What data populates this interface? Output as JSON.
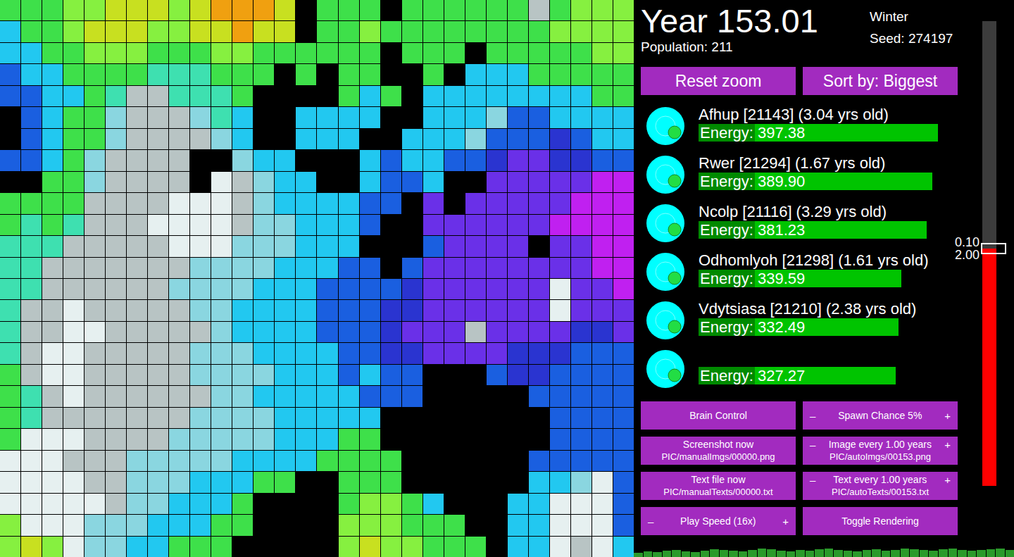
{
  "map": {
    "palette": [
      "#000000",
      "#1a5fe0",
      "#22c8f0",
      "#3ee0b0",
      "#3ee04a",
      "#86f040",
      "#c8e020",
      "#f0a010",
      "#b8c4c4",
      "#e6f0f0",
      "#6a30e8",
      "#c020f0",
      "#2a34d0",
      "#8ad6e0"
    ],
    "rows": [
      [
        4,
        4,
        4,
        5,
        5,
        6,
        6,
        6,
        5,
        6,
        7,
        7,
        7,
        6,
        0,
        4,
        4,
        4,
        0,
        4,
        4,
        4,
        4,
        4,
        4,
        8,
        4,
        5,
        5,
        5
      ],
      [
        2,
        4,
        4,
        5,
        6,
        6,
        6,
        5,
        5,
        6,
        6,
        7,
        6,
        6,
        0,
        4,
        4,
        5,
        4,
        4,
        4,
        4,
        4,
        4,
        4,
        4,
        5,
        5,
        5,
        5
      ],
      [
        2,
        2,
        4,
        4,
        5,
        5,
        5,
        4,
        4,
        4,
        5,
        5,
        4,
        4,
        4,
        4,
        4,
        4,
        0,
        4,
        4,
        4,
        0,
        4,
        4,
        4,
        4,
        4,
        5,
        5
      ],
      [
        1,
        2,
        2,
        4,
        4,
        4,
        4,
        3,
        3,
        3,
        4,
        4,
        4,
        0,
        4,
        0,
        4,
        4,
        0,
        0,
        4,
        0,
        2,
        2,
        2,
        4,
        4,
        4,
        4,
        4
      ],
      [
        1,
        1,
        2,
        2,
        4,
        3,
        8,
        8,
        3,
        3,
        3,
        4,
        0,
        0,
        0,
        0,
        4,
        2,
        4,
        0,
        2,
        2,
        2,
        2,
        2,
        2,
        2,
        2,
        4,
        4
      ],
      [
        0,
        1,
        2,
        4,
        4,
        13,
        8,
        8,
        8,
        13,
        3,
        2,
        0,
        0,
        2,
        2,
        2,
        2,
        0,
        0,
        2,
        2,
        2,
        13,
        1,
        1,
        2,
        2,
        2,
        2
      ],
      [
        0,
        1,
        2,
        4,
        4,
        13,
        8,
        8,
        8,
        8,
        13,
        2,
        0,
        0,
        2,
        2,
        2,
        0,
        0,
        2,
        2,
        2,
        13,
        1,
        1,
        1,
        12,
        1,
        2,
        2
      ],
      [
        1,
        1,
        2,
        4,
        13,
        8,
        8,
        8,
        8,
        0,
        0,
        13,
        2,
        2,
        0,
        0,
        0,
        2,
        1,
        2,
        2,
        1,
        1,
        12,
        10,
        10,
        12,
        12,
        1,
        1
      ],
      [
        0,
        0,
        4,
        4,
        13,
        8,
        8,
        8,
        8,
        0,
        9,
        8,
        13,
        2,
        2,
        0,
        0,
        2,
        1,
        1,
        2,
        0,
        0,
        10,
        10,
        10,
        10,
        10,
        11,
        11
      ],
      [
        4,
        4,
        4,
        4,
        8,
        8,
        8,
        8,
        9,
        9,
        9,
        8,
        13,
        2,
        2,
        2,
        2,
        1,
        1,
        0,
        10,
        0,
        10,
        10,
        10,
        10,
        10,
        11,
        11,
        11
      ],
      [
        4,
        3,
        4,
        3,
        8,
        8,
        8,
        9,
        9,
        9,
        9,
        8,
        13,
        13,
        2,
        2,
        2,
        1,
        0,
        0,
        10,
        10,
        10,
        10,
        10,
        10,
        11,
        11,
        11,
        11
      ],
      [
        3,
        3,
        3,
        8,
        8,
        8,
        8,
        8,
        9,
        9,
        9,
        13,
        13,
        13,
        2,
        2,
        2,
        0,
        0,
        0,
        1,
        10,
        10,
        10,
        10,
        0,
        10,
        10,
        11,
        11
      ],
      [
        3,
        3,
        8,
        8,
        8,
        8,
        8,
        8,
        8,
        13,
        13,
        13,
        13,
        2,
        2,
        2,
        1,
        1,
        0,
        1,
        10,
        10,
        10,
        10,
        10,
        10,
        10,
        10,
        11,
        11
      ],
      [
        3,
        3,
        8,
        8,
        8,
        8,
        8,
        8,
        13,
        13,
        13,
        13,
        2,
        2,
        2,
        1,
        1,
        1,
        1,
        12,
        10,
        10,
        10,
        10,
        10,
        10,
        9,
        10,
        10,
        11
      ],
      [
        3,
        8,
        8,
        9,
        8,
        8,
        8,
        8,
        8,
        13,
        13,
        2,
        2,
        2,
        2,
        1,
        1,
        1,
        12,
        12,
        10,
        10,
        10,
        10,
        10,
        10,
        9,
        10,
        10,
        10
      ],
      [
        3,
        8,
        8,
        9,
        9,
        8,
        8,
        8,
        8,
        8,
        13,
        2,
        2,
        2,
        2,
        1,
        1,
        1,
        12,
        10,
        10,
        10,
        8,
        10,
        10,
        10,
        10,
        12,
        12,
        10
      ],
      [
        3,
        8,
        9,
        9,
        8,
        8,
        8,
        8,
        8,
        13,
        13,
        13,
        2,
        2,
        2,
        2,
        1,
        1,
        12,
        12,
        10,
        10,
        10,
        10,
        12,
        12,
        12,
        1,
        1,
        1
      ],
      [
        4,
        8,
        9,
        9,
        8,
        8,
        8,
        8,
        8,
        13,
        13,
        13,
        13,
        2,
        2,
        2,
        1,
        2,
        1,
        1,
        0,
        0,
        0,
        1,
        12,
        12,
        1,
        1,
        1,
        1
      ],
      [
        4,
        3,
        8,
        9,
        8,
        8,
        8,
        8,
        8,
        8,
        13,
        13,
        2,
        2,
        2,
        2,
        2,
        1,
        1,
        1,
        0,
        0,
        0,
        0,
        0,
        1,
        1,
        1,
        1,
        1
      ],
      [
        4,
        3,
        8,
        8,
        8,
        8,
        8,
        8,
        8,
        13,
        13,
        13,
        13,
        2,
        2,
        2,
        2,
        2,
        0,
        0,
        0,
        0,
        0,
        0,
        0,
        0,
        1,
        1,
        1,
        1
      ],
      [
        4,
        9,
        9,
        9,
        8,
        8,
        8,
        8,
        13,
        13,
        13,
        13,
        13,
        2,
        2,
        2,
        4,
        4,
        0,
        0,
        0,
        0,
        0,
        0,
        0,
        0,
        1,
        1,
        1,
        1
      ],
      [
        9,
        9,
        9,
        8,
        8,
        8,
        13,
        13,
        13,
        13,
        13,
        2,
        2,
        2,
        2,
        4,
        4,
        4,
        4,
        0,
        0,
        0,
        0,
        0,
        0,
        1,
        1,
        1,
        1,
        1
      ],
      [
        9,
        9,
        9,
        9,
        8,
        8,
        13,
        13,
        13,
        2,
        2,
        2,
        4,
        4,
        0,
        0,
        4,
        4,
        4,
        0,
        0,
        0,
        0,
        0,
        0,
        2,
        2,
        13,
        9,
        1
      ],
      [
        9,
        9,
        9,
        9,
        9,
        8,
        13,
        13,
        2,
        2,
        2,
        4,
        0,
        0,
        0,
        0,
        4,
        5,
        5,
        4,
        2,
        0,
        0,
        0,
        2,
        2,
        9,
        9,
        9,
        1
      ],
      [
        5,
        9,
        9,
        9,
        13,
        13,
        13,
        2,
        2,
        2,
        4,
        4,
        0,
        0,
        0,
        0,
        5,
        5,
        5,
        4,
        4,
        4,
        0,
        0,
        2,
        2,
        9,
        9,
        9,
        1
      ],
      [
        5,
        6,
        5,
        9,
        13,
        13,
        2,
        2,
        4,
        4,
        4,
        0,
        0,
        0,
        0,
        0,
        5,
        6,
        5,
        5,
        4,
        4,
        4,
        0,
        2,
        2,
        9,
        8,
        9,
        2
      ]
    ]
  },
  "header": {
    "year": "Year 153.01",
    "season": "Winter",
    "seed": "Seed: 274197",
    "population": "Population: 211"
  },
  "top_buttons": [
    "Reset zoom",
    "Sort by: Biggest"
  ],
  "creatures": [
    {
      "name": "Afhup [21143] (3.04 yrs old)",
      "energy": "Energy: 397.38",
      "level": 0.85
    },
    {
      "name": "Rwer [21294] (1.67 yrs old)",
      "energy": "Energy: 389.90",
      "level": 0.83
    },
    {
      "name": "Ncolp [21116] (3.29 yrs old)",
      "energy": "Energy: 381.23",
      "level": 0.81
    },
    {
      "name": "Odhomlyoh [21298] (1.61 yrs old)",
      "energy": "Energy: 339.59",
      "level": 0.72
    },
    {
      "name": "Vdytsiasa [21210] (2.38 yrs old)",
      "energy": "Energy: 332.49",
      "level": 0.71
    },
    {
      "name": "",
      "energy": "Energy: 327.27",
      "level": 0.7
    }
  ],
  "controls": [
    {
      "kind": "button",
      "label": "Brain Control",
      "path": ""
    },
    {
      "kind": "stepper",
      "minus": "–",
      "label": "Spawn Chance 5%",
      "plus": "+",
      "path": ""
    },
    {
      "kind": "button",
      "label": "Screenshot now",
      "path": "PIC/manualImgs/00000.png"
    },
    {
      "kind": "stepper",
      "minus": "–",
      "label": "Image every 1.00 years",
      "plus": "+",
      "path": "PIC/autoImgs/00153.png"
    },
    {
      "kind": "button",
      "label": "Text file now",
      "path": "PIC/manualTexts/00000.txt"
    },
    {
      "kind": "stepper",
      "minus": "–",
      "label": "Text every 1.00 years",
      "plus": "+",
      "path": "PIC/autoTexts/00153.txt"
    },
    {
      "kind": "stepper",
      "minus": "–",
      "label": "Play Speed (16x)",
      "plus": "+",
      "path": ""
    },
    {
      "kind": "button",
      "label": "Toggle Rendering",
      "path": ""
    }
  ],
  "slider": {
    "labels": [
      "0.10",
      "2.00"
    ],
    "level": 0.51
  },
  "population_graph": {
    "values": [
      6,
      8,
      7,
      9,
      10,
      8,
      7,
      9,
      11,
      10,
      9,
      8,
      10,
      12,
      11,
      9,
      8,
      10,
      9,
      11,
      12,
      10,
      9,
      8,
      10,
      11,
      9,
      10,
      12,
      11,
      10,
      9,
      11,
      12,
      10,
      9,
      10,
      11,
      12,
      10
    ]
  }
}
